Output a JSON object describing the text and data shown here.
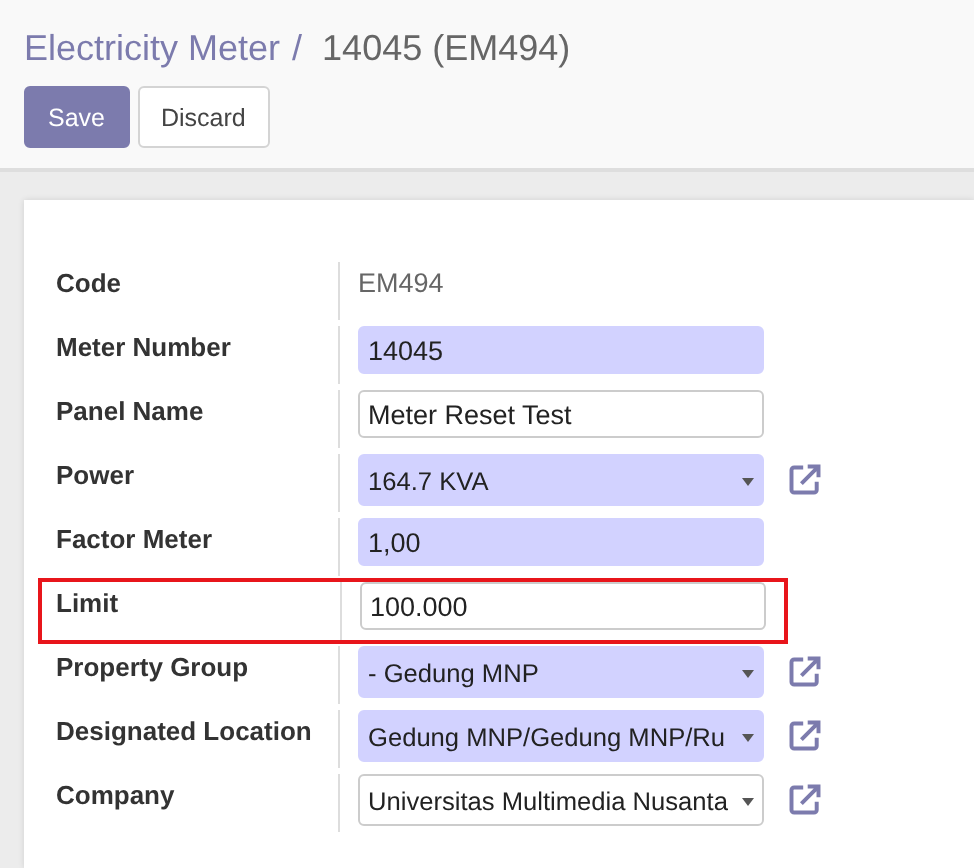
{
  "breadcrumb": {
    "parent": "Electricity Meter",
    "separator": "/",
    "current": "14045 (EM494)"
  },
  "buttons": [
    {
      "label": "Save",
      "kind": "primary"
    },
    {
      "label": "Discard",
      "kind": "secondary"
    }
  ],
  "fields": [
    {
      "label": "Code",
      "kind": "readonly",
      "value": "EM494",
      "has_link": false,
      "highlighted": false
    },
    {
      "label": "Meter Number",
      "kind": "input",
      "value": "14045",
      "required": true,
      "has_link": false,
      "highlighted": false
    },
    {
      "label": "Panel Name",
      "kind": "input",
      "value": "Meter Reset Test",
      "required": false,
      "has_link": false,
      "highlighted": false
    },
    {
      "label": "Power",
      "kind": "select",
      "value": "164.7 KVA",
      "required": true,
      "has_link": true,
      "highlighted": false
    },
    {
      "label": "Factor Meter",
      "kind": "input",
      "value": "1,00",
      "required": true,
      "has_link": false,
      "highlighted": false
    },
    {
      "label": "Limit",
      "kind": "input",
      "value": "100.000",
      "required": false,
      "has_link": false,
      "highlighted": true
    },
    {
      "label": "Property Group",
      "kind": "select",
      "value": "- Gedung MNP",
      "required": true,
      "has_link": true,
      "highlighted": false
    },
    {
      "label": "Designated Location",
      "kind": "select",
      "value": "Gedung MNP/Gedung MNP/Ru",
      "required": true,
      "has_link": true,
      "highlighted": false
    },
    {
      "label": "Company",
      "kind": "select",
      "value": "Universitas Multimedia Nusanta",
      "required": false,
      "has_link": true,
      "highlighted": false
    }
  ]
}
